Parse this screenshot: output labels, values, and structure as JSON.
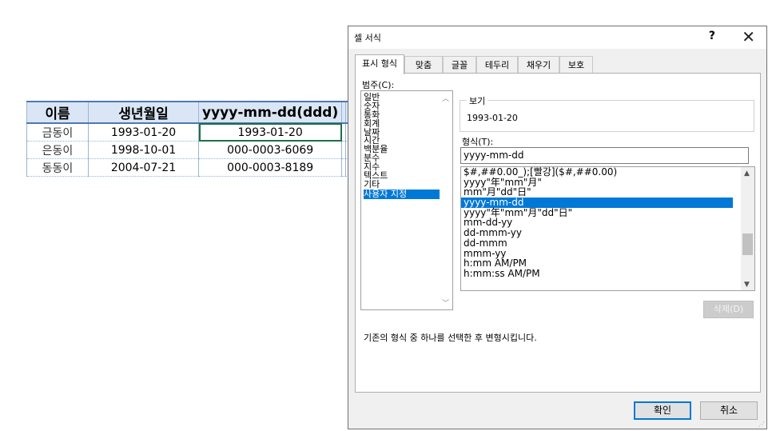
{
  "sheet": {
    "headers": [
      "이름",
      "생년월일",
      "yyyy-mm-dd(ddd)"
    ],
    "rows": [
      [
        "금동이",
        "1993-01-20",
        "1993-01-20"
      ],
      [
        "은동이",
        "1998-10-01",
        "000-0003-6069"
      ],
      [
        "동동이",
        "2004-07-21",
        "000-0003-8189"
      ]
    ]
  },
  "dialog": {
    "title": "셀 서식",
    "help_label": "?",
    "close_label": "✕",
    "tabs": [
      "표시 형식",
      "맞춤",
      "글꼴",
      "테두리",
      "채우기",
      "보호"
    ],
    "active_tab": 0,
    "category_label": "범주(C):",
    "categories": [
      "일반",
      "숫자",
      "통화",
      "회계",
      "날짜",
      "시간",
      "백분율",
      "분수",
      "지수",
      "텍스트",
      "기타",
      "사용자 지정"
    ],
    "selected_category": 11,
    "sample_label": "보기",
    "sample_value": "1993-01-20",
    "type_label": "형식(T):",
    "type_value": "yyyy-mm-dd",
    "formats": [
      "$#,##0.00_);[빨강]($#,##0.00)",
      "yyyy\"年\"mm\"月\"",
      "mm\"月\"dd\"日\"",
      "yyyy-mm-dd",
      "yyyy\"年\"mm\"月\"dd\"日\"",
      "mm-dd-yy",
      "dd-mmm-yy",
      "dd-mmm",
      "mmm-yy",
      "h:mm AM/PM",
      "h:mm:ss AM/PM"
    ],
    "selected_format": 3,
    "delete_label": "삭제(D)",
    "description": "기존의 형식 중 하나를 선택한 후 변형시킵니다.",
    "ok_label": "확인",
    "cancel_label": "취소"
  },
  "colors": {
    "selection": "#0078d7",
    "header_fill": "#dae6f5",
    "header_border": "#4e78b4",
    "active_cell_border": "#1e7145"
  }
}
